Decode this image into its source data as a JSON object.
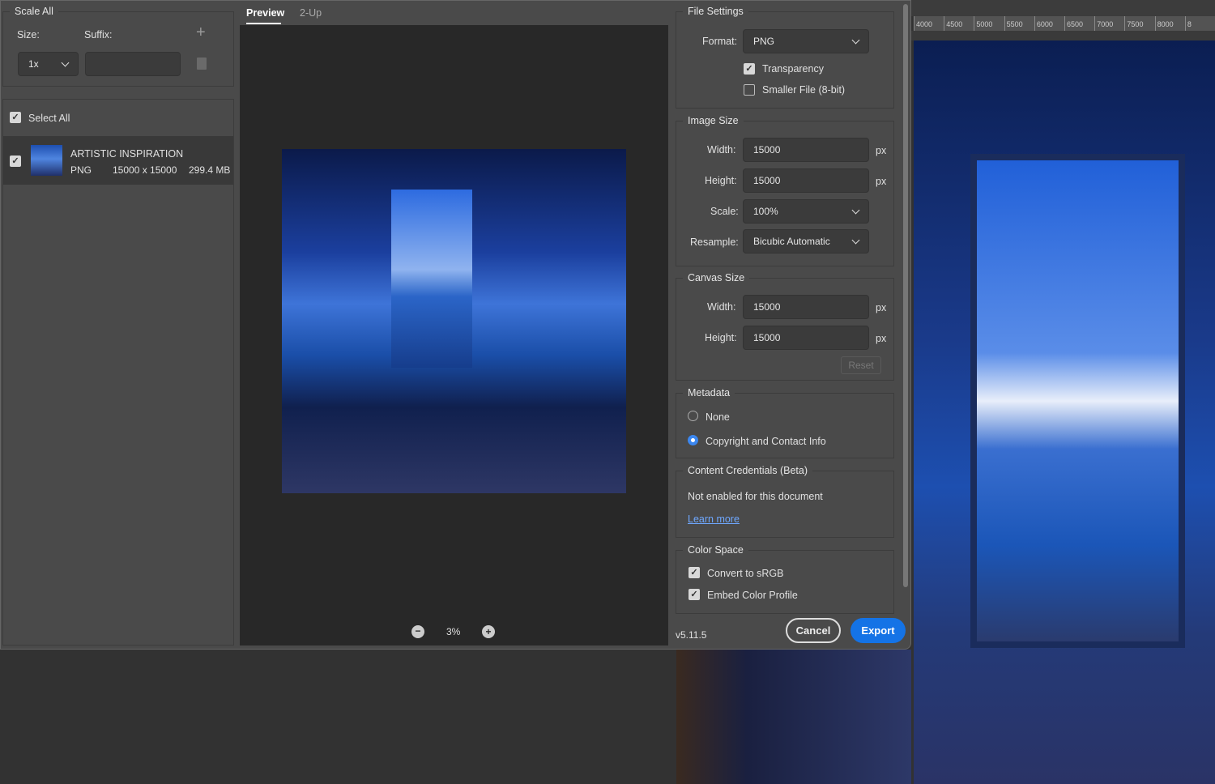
{
  "ruler": {
    "ticks": [
      "4000",
      "4500",
      "5000",
      "5500",
      "6000",
      "6500",
      "7000",
      "7500",
      "8000",
      "8"
    ]
  },
  "scale_all": {
    "title": "Scale All",
    "size_label": "Size:",
    "suffix_label": "Suffix:",
    "size_value": "1x",
    "suffix_value": ""
  },
  "assets": {
    "select_all": "Select All",
    "items": [
      {
        "name": "ARTISTIC INSPIRATION",
        "format": "PNG",
        "dimensions": "15000 x 15000",
        "size": "299.4 MB",
        "checked": true
      }
    ]
  },
  "tabs": [
    {
      "label": "Preview",
      "active": true
    },
    {
      "label": "2-Up",
      "active": false
    }
  ],
  "zoom": {
    "value": "3%"
  },
  "file_settings": {
    "title": "File Settings",
    "format_label": "Format:",
    "format_value": "PNG",
    "transparency": "Transparency",
    "transparency_checked": true,
    "smaller_file": "Smaller File (8-bit)",
    "smaller_file_checked": false
  },
  "image_size": {
    "title": "Image Size",
    "width_label": "Width:",
    "width": "15000",
    "height_label": "Height:",
    "height": "15000",
    "unit": "px",
    "scale_label": "Scale:",
    "scale": "100%",
    "resample_label": "Resample:",
    "resample": "Bicubic Automatic"
  },
  "canvas_size": {
    "title": "Canvas Size",
    "width_label": "Width:",
    "width": "15000",
    "height_label": "Height:",
    "height": "15000",
    "unit": "px",
    "reset": "Reset"
  },
  "metadata": {
    "title": "Metadata",
    "none": "None",
    "copyright": "Copyright and Contact Info",
    "selected": "copyright"
  },
  "content_credentials": {
    "title": "Content Credentials (Beta)",
    "status": "Not enabled for this document",
    "learn_more": "Learn more"
  },
  "color_space": {
    "title": "Color Space",
    "convert": "Convert to sRGB",
    "embed": "Embed Color Profile",
    "convert_checked": true,
    "embed_checked": true
  },
  "footer": {
    "version": "v5.11.5",
    "cancel": "Cancel",
    "export": "Export"
  },
  "colors": {
    "accent": "#1473e6",
    "link": "#6fa8ff"
  }
}
